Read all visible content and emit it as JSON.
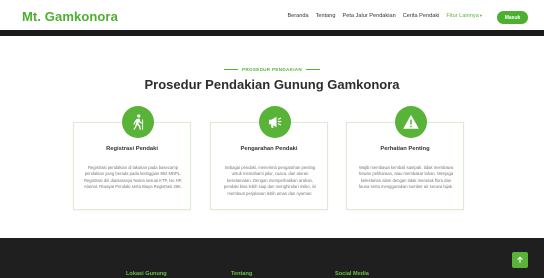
{
  "brand": {
    "name": "Mt. Gamkonora"
  },
  "nav": {
    "links": [
      "Beranda",
      "Tentang",
      "Peta Jalur Pendakian",
      "Cerita Pendaki"
    ],
    "dropdown": "Fitur Lainnya",
    "button": "Masuk"
  },
  "section": {
    "tag": "PROSEDUR PENDAKIAN",
    "title": "Prosedur Pendakian Gunung Gamkonora"
  },
  "cards": [
    {
      "icon": "hiker-icon",
      "title": "Registrasi Pendaki",
      "desc": "Registrasi pendakian di lakukan pada basecamp pendakian yang berada pada ketinggian 862 MDPL. Registrasi diri diantaranya Nama sesuai KTP, No HP, Alamat, Riwayat Pendaki serta Biaya Registrasi 25K."
    },
    {
      "icon": "megaphone-icon",
      "title": "Pengarahan Pendaki",
      "desc": "Sebagai pendaki, menerima pengarahan penting untuk memahami jalur, cuaca, dan aturan keselamatan. Dengan memperhatikan arahan, pendaki bisa lebih siap dan menghindari risiko, ini membuat perjalanan lebih aman dan nyaman."
    },
    {
      "icon": "warning-icon",
      "title": "Perhatian Penting",
      "desc": "Wajib membawa kembali sampah, tidak membawa hewan peliharaan, atau membakar lahan. Menjaga kelestarian alam dengan tidak merusak flora dan fauna serta menggunakan sumber air secara bijak."
    }
  ],
  "footer": {
    "headings": [
      "Lokasi Gunung",
      "Tentang",
      "Social Media"
    ]
  },
  "colors": {
    "accent": "#58b338",
    "brand": "#4caf2f",
    "footer_bg": "#1f1f1f"
  }
}
